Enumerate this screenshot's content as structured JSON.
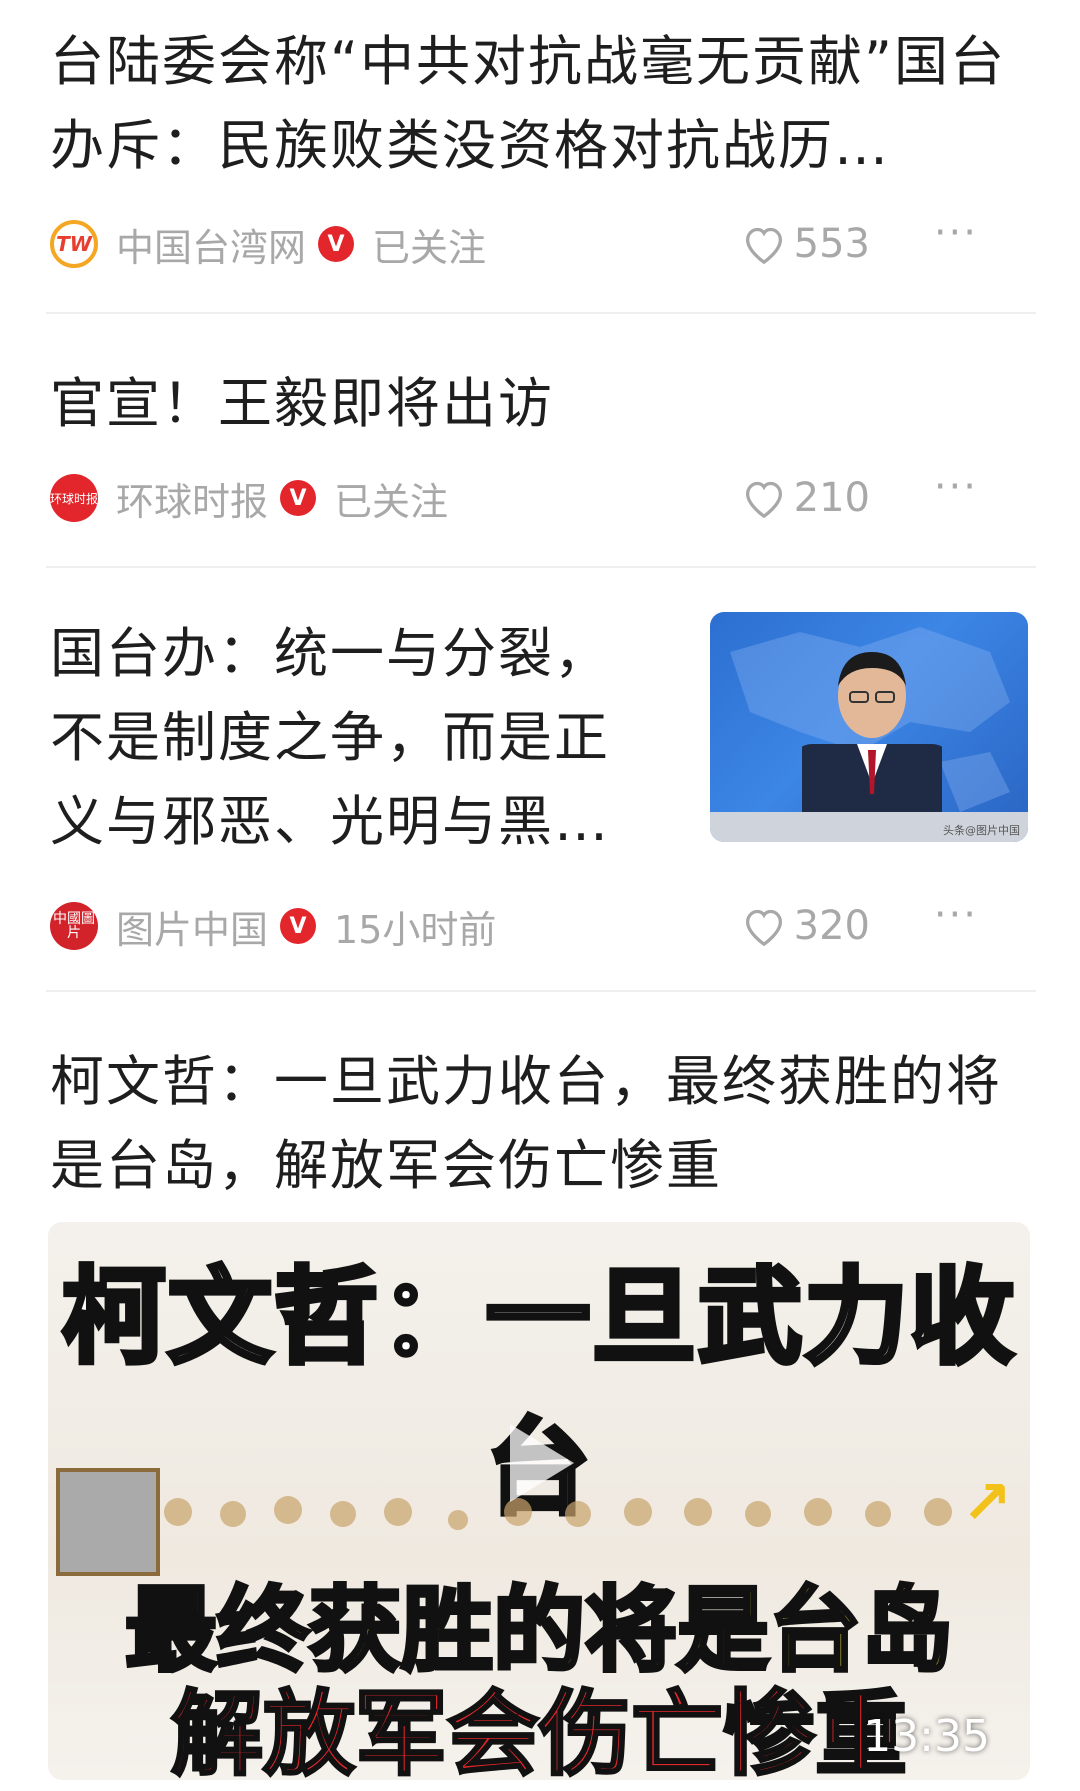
{
  "feed": {
    "items": [
      {
        "title": "台陆委会称“中共对抗战毫无贡献”国台办斥：民族败类没资格对抗战历…",
        "source": "中国台湾网",
        "status": "已关注",
        "likes": "553",
        "avatar_text": "TW"
      },
      {
        "title": "官宣！王毅即将出访",
        "source": "环球时报",
        "status": "已关注",
        "likes": "210",
        "avatar_text": "环球时报"
      },
      {
        "title": "国台办：统一与分裂，不是制度之争，而是正义与邪恶、光明与黑…",
        "source": "图片中国",
        "status": "15小时前",
        "likes": "320",
        "avatar_text": "中國圖片",
        "thumbnail_watermark": "头条@图片中国"
      },
      {
        "title": "柯文哲：一旦武力收台，最终获胜的将是台岛，解放军会伤亡惨重",
        "video": {
          "caption_top": "柯文哲：一旦武力收台",
          "caption_line1": "最终获胜的将是台岛",
          "caption_line2": "解放军会伤亡惨重",
          "duration": "13:35"
        }
      }
    ]
  },
  "ui": {
    "verified_mark": "V",
    "more": "···"
  },
  "colors": {
    "accent_red": "#e3262c",
    "meta_gray": "#a8a8a8",
    "caption_yellow": "#f6e94a"
  },
  "icons": [
    "heart-outline-icon",
    "more-dots-icon",
    "verified-badge-icon",
    "play-icon",
    "cursor-icon"
  ]
}
